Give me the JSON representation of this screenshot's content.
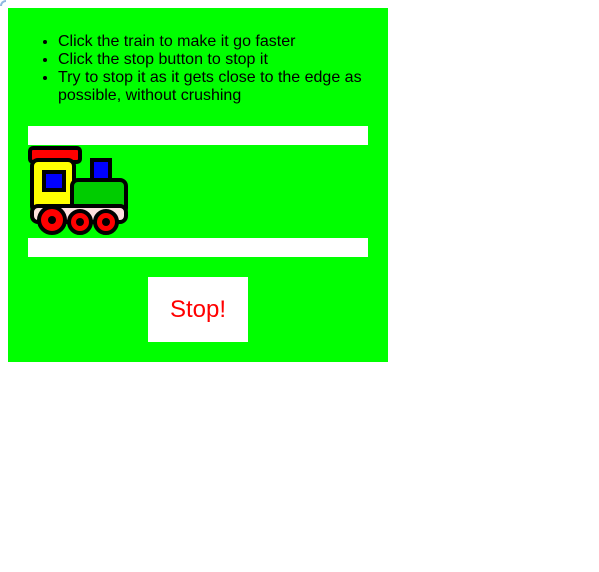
{
  "instructions": [
    "Click the train to make it go faster",
    "Click the stop button to stop it",
    "Try to stop it as it gets close to the edge as possible, without crushing"
  ],
  "stop_button": {
    "label": "Stop!"
  },
  "train": {
    "icon": "train-icon"
  },
  "colors": {
    "panel": "#00ff00",
    "rail": "#ffffff",
    "stop_text": "#ff0000"
  }
}
